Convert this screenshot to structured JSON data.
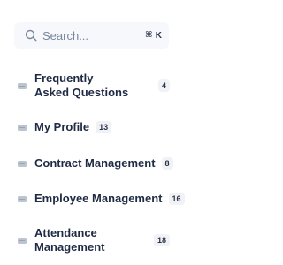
{
  "search": {
    "placeholder": "Search...",
    "shortcut_symbol": "⌘",
    "shortcut_key": "K"
  },
  "sidebar": {
    "items": [
      {
        "label": "Frequently Asked Questions",
        "count": "4"
      },
      {
        "label": "My Profile",
        "count": "13"
      },
      {
        "label": "Contract Management",
        "count": "8"
      },
      {
        "label": "Employee Management",
        "count": "16"
      },
      {
        "label": "Attendance Management",
        "count": "18"
      }
    ]
  }
}
